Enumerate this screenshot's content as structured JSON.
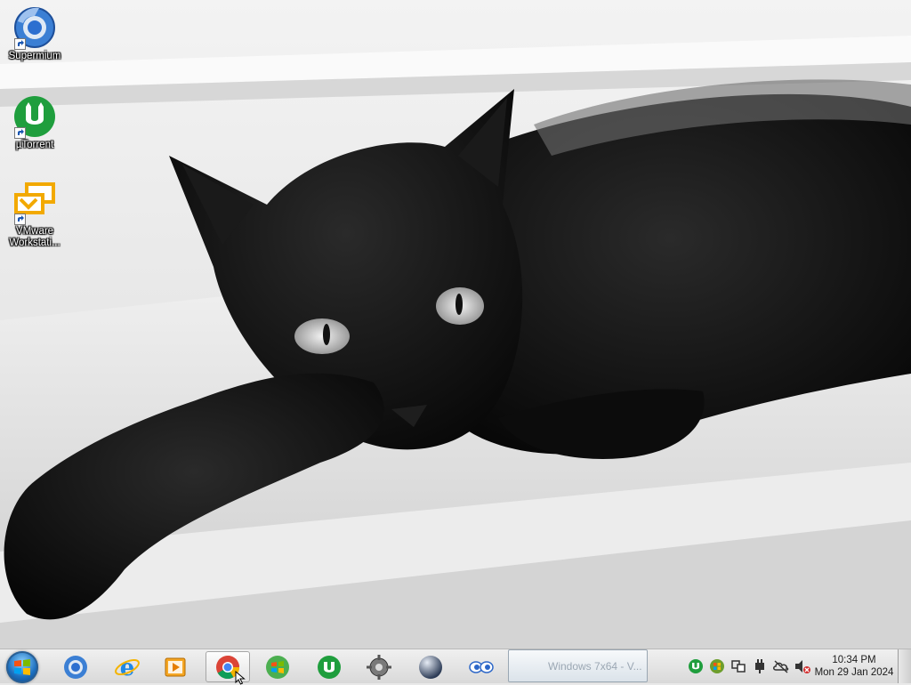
{
  "desktop": {
    "icons": [
      {
        "label": "Supermium",
        "icon": "supermium-icon"
      },
      {
        "label": "µTorrent",
        "icon": "utorrent-icon"
      },
      {
        "label": "VMware\nWorkstati...",
        "icon": "vmware-icon"
      }
    ]
  },
  "taskbar": {
    "start_icon": "windows-logo-icon",
    "pinned": [
      {
        "name": "supermium",
        "icon": "supermium-icon"
      },
      {
        "name": "internet-explorer",
        "icon": "ie-icon"
      },
      {
        "name": "media-player",
        "icon": "media-player-icon"
      },
      {
        "name": "chrome",
        "icon": "chrome-icon",
        "active": true
      },
      {
        "name": "windows-update",
        "icon": "windows-orb-icon"
      },
      {
        "name": "utorrent",
        "icon": "utorrent-icon"
      },
      {
        "name": "settings",
        "icon": "gear-icon"
      },
      {
        "name": "orb-app",
        "icon": "sphere-icon"
      },
      {
        "name": "eyes-app",
        "icon": "eyes-icon"
      }
    ],
    "window_task_label": "Windows 7x64 - V...",
    "tray_icons": [
      "utorrent-tray-icon",
      "windows-update-tray-icon",
      "network-tray-icon",
      "power-tray-icon",
      "onedrive-tray-icon",
      "volume-muted-icon"
    ],
    "clock": {
      "time": "10:34 PM",
      "date": "Mon 29 Jan 2024"
    }
  },
  "colors": {
    "utorrent_green": "#1f9e3d",
    "vmware_orange": "#f2a900",
    "taskbar_bg": "#e0e0e0"
  }
}
